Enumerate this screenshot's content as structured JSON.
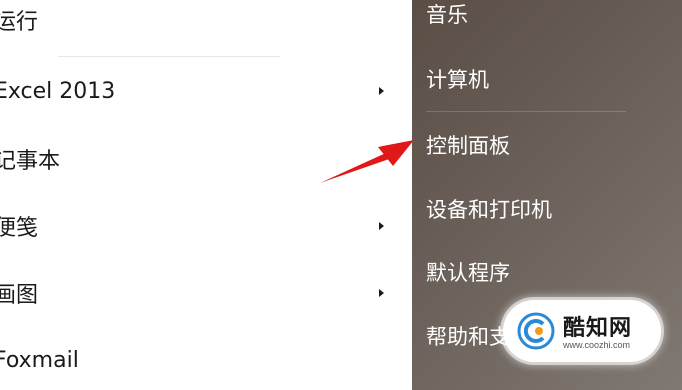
{
  "programs": [
    {
      "label": "运行"
    },
    {
      "label": "Excel 2013",
      "submenu": true
    },
    {
      "label": "记事本"
    },
    {
      "label": "便笺",
      "submenu": true
    },
    {
      "label": "画图",
      "submenu": true
    },
    {
      "label": "Foxmail"
    }
  ],
  "places": [
    {
      "label": "音乐"
    },
    {
      "label": "计算机"
    },
    {
      "label": "控制面板"
    },
    {
      "label": "设备和打印机"
    },
    {
      "label": "默认程序"
    },
    {
      "label": "帮助和支持"
    }
  ],
  "watermark": {
    "title": "酷知网",
    "url": "www.coozhi.com"
  },
  "colors": {
    "places_bg": "#6a6059",
    "annotation_arrow": "#e01818"
  }
}
